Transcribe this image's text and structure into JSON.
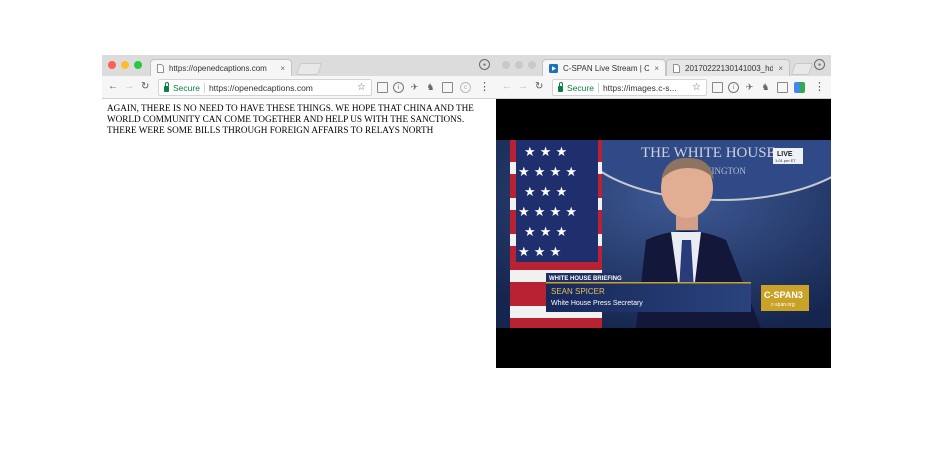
{
  "left_window": {
    "tab": {
      "title": "https://openedcaptions.com",
      "close": "×"
    },
    "omnibox": {
      "secure_label": "Secure",
      "url": "https://openedcaptions.com"
    },
    "caption_text": "AGAIN, THERE IS NO NEED TO HAVE THESE THINGS. WE HOPE THAT CHINA AND THE WORLD COMMUNITY CAN COME TOGETHER AND HELP US WITH THE SANCTIONS. THERE WERE SOME BILLS THROUGH FOREIGN AFFAIRS TO RELAYS NORTH"
  },
  "right_window": {
    "tabs": [
      {
        "title": "C-SPAN Live Stream | C-",
        "close": "×"
      },
      {
        "title": "20170222130141003_hd.",
        "close": "×"
      }
    ],
    "omnibox": {
      "secure_label": "Secure",
      "url": "https://images.c-s..."
    },
    "video": {
      "backdrop_text": "THE WHITE HOUSE",
      "backdrop_subtext": "WASHINGTON",
      "live_badge": "LIVE",
      "live_time": "1:01 pm ET",
      "lower_third_tag": "WHITE HOUSE BRIEFING",
      "speaker_name": "SEAN SPICER",
      "speaker_title": "White House Press Secretary",
      "network_logo": "C-SPAN3",
      "network_url": "c-span.org"
    }
  },
  "icons": {
    "back": "←",
    "forward": "→",
    "reload": "↻",
    "star": "☆",
    "menu": "⋮"
  },
  "colors": {
    "mac_close": "#fe5f57",
    "mac_min": "#febc2e",
    "mac_max": "#28c840",
    "secure_green": "#0b8043",
    "cspan_gold": "#c9a227",
    "lower_third_blue": "#1d2f63"
  }
}
